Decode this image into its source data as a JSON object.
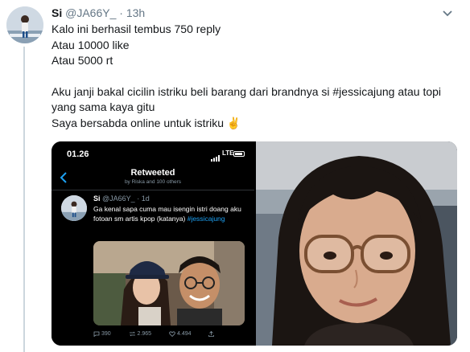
{
  "tweet": {
    "name": "Si",
    "handle": "@JA66Y_",
    "dot": "·",
    "time": "13h",
    "lines": [
      "Kalo ini berhasil tembus 750 reply",
      "Atau 10000 like",
      "Atau 5000 rt",
      "",
      "Aku janji bakal cicilin istriku beli barang dari brandnya si #jessicajung atau topi",
      "yang sama kaya gitu",
      "Saya bersabda online untuk istriku ✌️"
    ]
  },
  "screenshot": {
    "status_time": "01.26",
    "network": "LTE",
    "title": "Retweeted",
    "subtitle": "by Riska and 100 others",
    "inner_tweet": {
      "name": "Si",
      "handle": "@JA66Y_",
      "age": "· 1d",
      "text": "Ga kenal sapa cuma mau isengin istri doang aku fotoan sm artis kpop (katanya)",
      "hashtag": "#jessicajung",
      "replies": "390",
      "retweets": "2.965",
      "likes": "4.494"
    }
  },
  "icons": {
    "more": "chevron-down-icon",
    "back": "chevron-left-icon",
    "reply": "reply-icon",
    "retweet": "retweet-icon",
    "like": "heart-icon",
    "share": "share-icon"
  },
  "colors": {
    "text": "#14171a",
    "muted": "#657786",
    "link": "#1da1f2",
    "dark_bg": "#000000"
  }
}
